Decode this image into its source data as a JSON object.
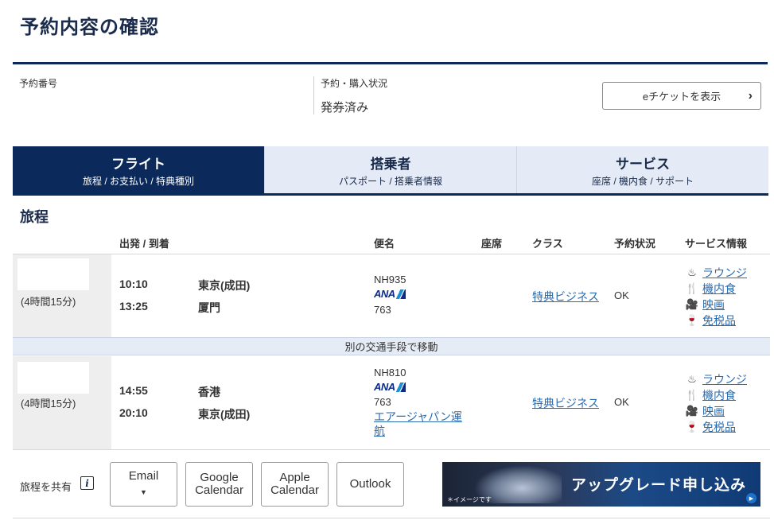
{
  "page": {
    "title": "予約内容の確認"
  },
  "reservation": {
    "number_label": "予約番号",
    "status_label": "予約・購入状況",
    "status_value": "発券済み",
    "eticket_button": "eチケットを表示"
  },
  "tabs": [
    {
      "label": "フライト",
      "sub": "旅程 / お支払い / 特典種別",
      "active": true
    },
    {
      "label": "搭乗者",
      "sub": "パスポート / 搭乗者情報",
      "active": false
    },
    {
      "label": "サービス",
      "sub": "座席 / 機内食 / サポート",
      "active": false
    }
  ],
  "itinerary": {
    "title": "旅程",
    "columns": {
      "dep_arr": "出発 / 到着",
      "flight": "便名",
      "seat": "座席",
      "class": "クラス",
      "status": "予約状況",
      "service": "サービス情報"
    },
    "segments": [
      {
        "duration": "(4時間15分)",
        "dep_time": "10:10",
        "dep_city": "東京(成田)",
        "arr_time": "13:25",
        "arr_city": "厦門",
        "flight_no": "NH935",
        "airline_logo": "ANA",
        "aircraft": "763",
        "operator": "",
        "fare_class": "特典ビジネス",
        "status": "OK"
      },
      {
        "duration": "(4時間15分)",
        "dep_time": "14:55",
        "dep_city": "香港",
        "arr_time": "20:10",
        "arr_city": "東京(成田)",
        "flight_no": "NH810",
        "airline_logo": "ANA",
        "aircraft": "763",
        "operator": "エアージャパン運航",
        "fare_class": "特典ビジネス",
        "status": "OK"
      }
    ],
    "transfer_note": "別の交通手段で移動",
    "services": [
      {
        "label": "ラウンジ",
        "icon": "lounge-icon"
      },
      {
        "label": "機内食",
        "icon": "meal-icon"
      },
      {
        "label": "映画",
        "icon": "movie-icon"
      },
      {
        "label": "免税品",
        "icon": "dutyfree-icon"
      }
    ]
  },
  "share": {
    "label": "旅程を共有",
    "info_icon": "i",
    "email": "Email",
    "google_l1": "Google",
    "google_l2": "Calendar",
    "apple_l1": "Apple",
    "apple_l2": "Calendar",
    "outlook": "Outlook"
  },
  "banner": {
    "text": "アップグレード申し込み",
    "note": "＊イメージです"
  },
  "colors": {
    "navy": "#0b2a5b",
    "link": "#2a6bb0",
    "tab_inactive": "#e4ebf6"
  }
}
